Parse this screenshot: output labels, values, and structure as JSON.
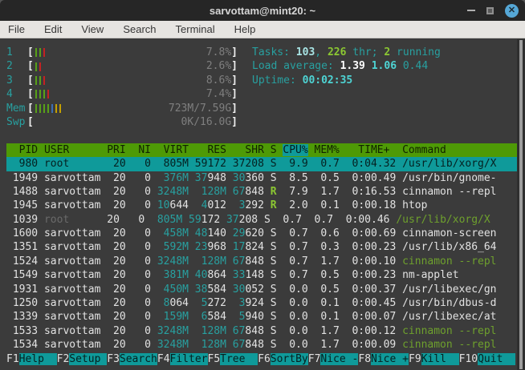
{
  "window": {
    "title": "sarvottam@mint20: ~"
  },
  "menu": {
    "items": [
      "File",
      "Edit",
      "View",
      "Search",
      "Terminal",
      "Help"
    ]
  },
  "colors": {
    "header_green": "#4e9a06",
    "selection_teal": "#0f9a9a",
    "text_teal": "#28a0a0",
    "close_button_blue": "#55a7d6",
    "terminal_background": "#3b3b3b"
  },
  "meters": [
    {
      "label": "1",
      "bars": [
        "g",
        "g",
        "r"
      ],
      "value": "7.8%"
    },
    {
      "label": "2",
      "bars": [
        "g",
        "r"
      ],
      "value": "2.6%"
    },
    {
      "label": "3",
      "bars": [
        "g",
        "g",
        "r"
      ],
      "value": "8.6%"
    },
    {
      "label": "4",
      "bars": [
        "g",
        "g",
        "g",
        "r"
      ],
      "value": "7.4%"
    },
    {
      "label": "Mem",
      "bars": [
        "g",
        "g",
        "g",
        "g",
        "b",
        "y",
        "y"
      ],
      "value": "723M/7.59G"
    },
    {
      "label": "Swp",
      "bars": [],
      "value": "0K/16.0G"
    }
  ],
  "summary": [
    {
      "name": "tasks",
      "segments": [
        [
          "Tasks: ",
          "c"
        ],
        [
          "103",
          "cl"
        ],
        [
          ", ",
          "c"
        ],
        [
          "226",
          "gb"
        ],
        [
          " thr; ",
          "c"
        ],
        [
          "2",
          "gb"
        ],
        [
          " running",
          "c"
        ]
      ]
    },
    {
      "name": "load-average",
      "segments": [
        [
          "Load average: ",
          "c"
        ],
        [
          "1.39 ",
          "wb"
        ],
        [
          "1.06 ",
          "cb"
        ],
        [
          "0.44",
          "c"
        ]
      ]
    },
    {
      "name": "uptime",
      "segments": [
        [
          "Uptime: ",
          "c"
        ],
        [
          "00:02:35",
          "cb"
        ]
      ]
    }
  ],
  "table": {
    "sort_column": "CPU%",
    "header_segments": [
      [
        "  PID USER      PRI  NI  VIRT   RES   SHR S ",
        "h"
      ],
      [
        "CPU%",
        "hs"
      ],
      [
        " MEM%   TIME+  Command",
        "h"
      ]
    ],
    "rows": [
      {
        "pid": "980",
        "selected": true,
        "segments": [
          [
            "  980 root       20   0  805M 59172 37208 S  9.9  0.7  0:04.32 /usr/lib/xorg/X",
            "w"
          ]
        ]
      },
      {
        "pid": "1949",
        "segments": [
          [
            " 1949 sarvottam  20   0 ",
            "w"
          ],
          [
            " 376M 37",
            "t"
          ],
          [
            "948 ",
            "w"
          ],
          [
            "30",
            "t"
          ],
          [
            "360 S  8.5  0.5  0:00.49 /usr/bin/gnome-",
            "w"
          ]
        ]
      },
      {
        "pid": "1488",
        "segments": [
          [
            " 1488 sarvottam  20   0 ",
            "w"
          ],
          [
            "3248M  128M 67",
            "t"
          ],
          [
            "848 ",
            "w"
          ],
          [
            "R",
            "gb"
          ],
          [
            "  7.9  1.7  0:16.53 cinnamon --repl",
            "w"
          ]
        ]
      },
      {
        "pid": "1945",
        "segments": [
          [
            " 1945 sarvottam  20   0 ",
            "w"
          ],
          [
            "10",
            "t"
          ],
          [
            "644  ",
            "w"
          ],
          [
            "4",
            "t"
          ],
          [
            "012  ",
            "w"
          ],
          [
            "3",
            "t"
          ],
          [
            "292 ",
            "w"
          ],
          [
            "R",
            "gb"
          ],
          [
            "  2.0  0.1  0:00.18 htop",
            "w"
          ]
        ]
      },
      {
        "pid": "1039",
        "segments": [
          [
            " 1039 ",
            "w"
          ],
          [
            "root     ",
            "d"
          ],
          [
            " 20   0 ",
            "w"
          ],
          [
            " 805M 59",
            "t"
          ],
          [
            "172 ",
            "w"
          ],
          [
            "37",
            "t"
          ],
          [
            "208 S  0.7  0.7  0:00.46 ",
            "w"
          ],
          [
            "/usr/lib/xorg/X",
            "g"
          ]
        ]
      },
      {
        "pid": "1600",
        "segments": [
          [
            " 1600 sarvottam  20   0 ",
            "w"
          ],
          [
            " 458M 48",
            "t"
          ],
          [
            "140 ",
            "w"
          ],
          [
            "29",
            "t"
          ],
          [
            "620 S  0.7  0.6  0:00.69 cinnamon-screen",
            "w"
          ]
        ]
      },
      {
        "pid": "1351",
        "segments": [
          [
            " 1351 sarvottam  20   0 ",
            "w"
          ],
          [
            " 592M 23",
            "t"
          ],
          [
            "968 ",
            "w"
          ],
          [
            "17",
            "t"
          ],
          [
            "824 S  0.7  0.3  0:00.23 /usr/lib/x86_64",
            "w"
          ]
        ]
      },
      {
        "pid": "1524",
        "segments": [
          [
            " 1524 sarvottam  20   0 ",
            "w"
          ],
          [
            "3248M  128M 67",
            "t"
          ],
          [
            "848 S  0.7  1.7  0:00.10 ",
            "w"
          ],
          [
            "cinnamon --repl",
            "g"
          ]
        ]
      },
      {
        "pid": "1549",
        "segments": [
          [
            " 1549 sarvottam  20   0 ",
            "w"
          ],
          [
            " 381M 40",
            "t"
          ],
          [
            "864 ",
            "w"
          ],
          [
            "33",
            "t"
          ],
          [
            "148 S  0.7  0.5  0:00.23 nm-applet",
            "w"
          ]
        ]
      },
      {
        "pid": "1931",
        "segments": [
          [
            " 1931 sarvottam  20   0 ",
            "w"
          ],
          [
            " 450M 38",
            "t"
          ],
          [
            "584 ",
            "w"
          ],
          [
            "30",
            "t"
          ],
          [
            "052 S  0.0  0.5  0:00.37 /usr/libexec/gn",
            "w"
          ]
        ]
      },
      {
        "pid": "1250",
        "segments": [
          [
            " 1250 sarvottam  20   0  ",
            "w"
          ],
          [
            "8",
            "t"
          ],
          [
            "064  ",
            "w"
          ],
          [
            "5",
            "t"
          ],
          [
            "272  ",
            "w"
          ],
          [
            "3",
            "t"
          ],
          [
            "924 S  0.0  0.1  0:00.45 /usr/bin/dbus-d",
            "w"
          ]
        ]
      },
      {
        "pid": "1339",
        "segments": [
          [
            " 1339 sarvottam  20   0 ",
            "w"
          ],
          [
            " 159M  6",
            "t"
          ],
          [
            "584  ",
            "w"
          ],
          [
            "5",
            "t"
          ],
          [
            "940 S  0.0  0.1  0:00.07 /usr/libexec/at",
            "w"
          ]
        ]
      },
      {
        "pid": "1533",
        "segments": [
          [
            " 1533 sarvottam  20   0 ",
            "w"
          ],
          [
            "3248M  128M 67",
            "t"
          ],
          [
            "848 S  0.0  1.7  0:00.12 ",
            "w"
          ],
          [
            "cinnamon --repl",
            "g"
          ]
        ]
      },
      {
        "pid": "1534",
        "segments": [
          [
            " 1534 sarvottam  20   0 ",
            "w"
          ],
          [
            "3248M  128M 67",
            "t"
          ],
          [
            "848 S  0.0  1.7  0:00.09 ",
            "w"
          ],
          [
            "cinnamon --repl",
            "g"
          ]
        ]
      }
    ]
  },
  "fnbar": [
    {
      "key": "F1",
      "label": "Help  "
    },
    {
      "key": "F2",
      "label": "Setup "
    },
    {
      "key": "F3",
      "label": "Search"
    },
    {
      "key": "F4",
      "label": "Filter"
    },
    {
      "key": "F5",
      "label": "Tree  "
    },
    {
      "key": "F6",
      "label": "SortBy"
    },
    {
      "key": "F7",
      "label": "Nice -"
    },
    {
      "key": "F8",
      "label": "Nice +"
    },
    {
      "key": "F9",
      "label": "Kill  "
    },
    {
      "key": "F10",
      "label": "Quit  "
    }
  ]
}
